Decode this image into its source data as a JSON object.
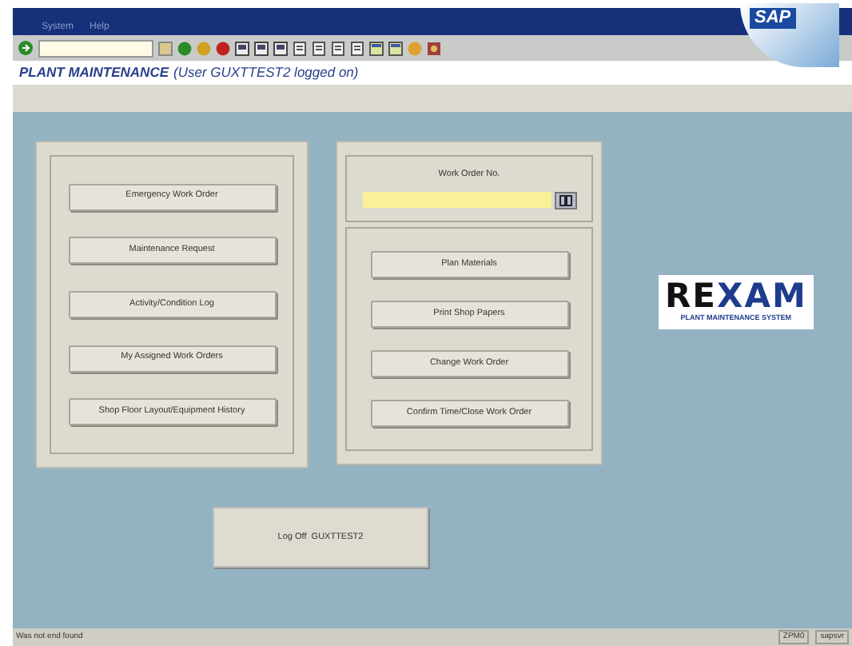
{
  "menu_bar": [
    "System",
    "Help"
  ],
  "brand": "SAP",
  "screen_title": {
    "main": "PLANT MAINTENANCE",
    "user": "(User GUXTTEST2 logged on)"
  },
  "left_buttons": [
    "Emergency Work Order",
    "Maintenance Request",
    "Activity/Condition Log",
    "My Assigned Work Orders",
    "Shop Floor Layout/Equipment History"
  ],
  "work_order_field": {
    "label": "Work Order No."
  },
  "right_buttons": [
    "Plan Materials",
    "Print Shop Papers",
    "Change Work Order",
    "Confirm Time/Close Work Order"
  ],
  "logo": {
    "parts": [
      {
        "text": "RE",
        "color": "#111111"
      },
      {
        "text": "XAM",
        "color": "#1d3c8c"
      }
    ],
    "tagline": "PLANT MAINTENANCE SYSTEM"
  },
  "logoff_button": "Log Off  GUXTTEST2",
  "status_bar": {
    "message": "Was not end found",
    "system": "ZPM0",
    "server": "sapsvr"
  }
}
